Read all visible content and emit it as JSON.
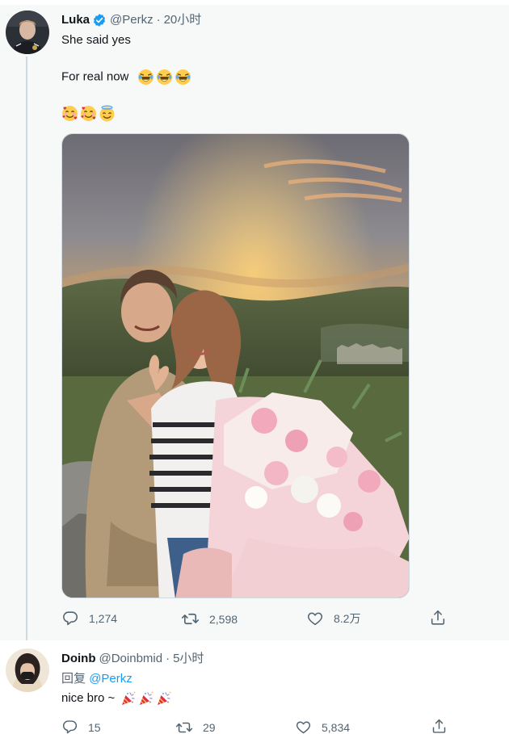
{
  "tweet": {
    "author_name": "Luka",
    "author_handle": "@Perkz",
    "time": "20小时",
    "line1": "She said yes",
    "line2": "For real now",
    "line2_emojis": [
      "face-with-tears-of-joy",
      "face-with-tears-of-joy",
      "face-with-tears-of-joy"
    ],
    "line3_emojis": [
      "smiling-face-with-hearts",
      "smiling-face-with-hearts",
      "smiling-face-with-halo"
    ],
    "photo": "engagement-photo",
    "replies": "1,274",
    "retweets": "2,598",
    "likes": "8.2万"
  },
  "reply": {
    "author_name": "Doinb",
    "author_handle": "@Doinbmid",
    "time": "5小时",
    "reply_prefix": "回复",
    "reply_to": "@Perkz",
    "text": "nice bro ~",
    "emojis": [
      "party-popper",
      "party-popper",
      "party-popper"
    ],
    "replies": "15",
    "retweets": "29",
    "likes": "5,834"
  },
  "colors": {
    "verified": "#1d9bf0",
    "link": "#1d9bf0",
    "secondary_text": "#536471"
  }
}
